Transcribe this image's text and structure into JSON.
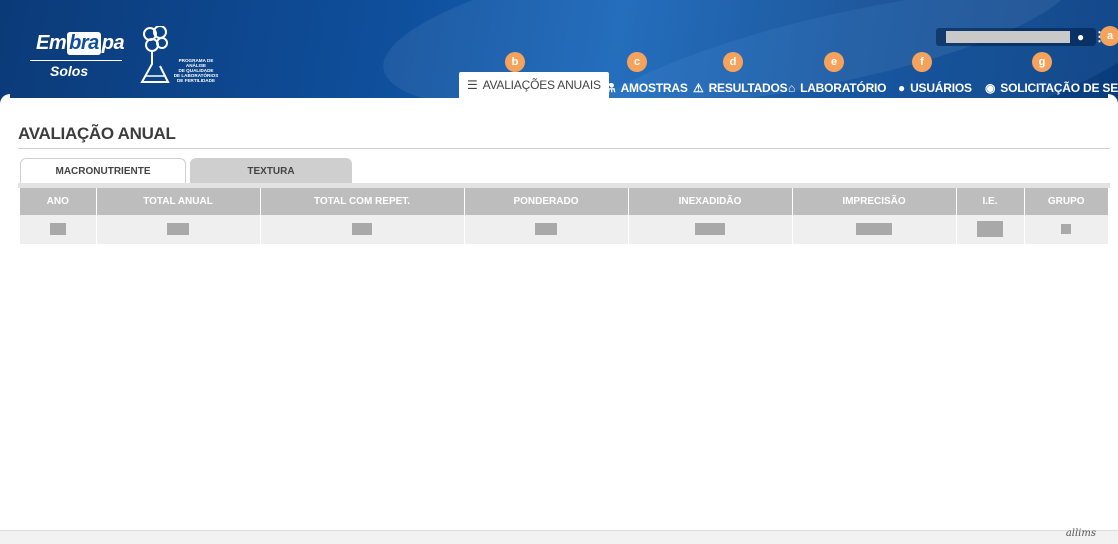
{
  "header": {
    "logo": {
      "brand": "Em",
      "brand_mid": "bra",
      "brand_end": "pa",
      "sub": "Solos"
    },
    "program_text": [
      "PROGRAMA DE ANÁLISE",
      "DE QUALIDADE",
      "DE LABORATÓRIOS",
      "DE FERTILIDADE"
    ],
    "user_badge": "a"
  },
  "nav": [
    {
      "label": "AVALIAÇÕES ANUAIS",
      "icon": "list-icon",
      "glyph": "☰",
      "badge": "b",
      "active": true
    },
    {
      "label": "AMOSTRAS",
      "icon": "samples-icon",
      "glyph": "⚗",
      "badge": "c",
      "active": false
    },
    {
      "label": "RESULTADOS",
      "icon": "flask-icon",
      "glyph": "⚠",
      "badge": "d",
      "active": false
    },
    {
      "label": "LABORATÓRIO",
      "icon": "home-icon",
      "glyph": "⌂",
      "badge": "e",
      "active": false
    },
    {
      "label": "USUÁRIOS",
      "icon": "user-icon",
      "glyph": "●",
      "badge": "f",
      "active": false
    },
    {
      "label": "SOLICITAÇÃO DE SELOS",
      "icon": "seal-icon",
      "glyph": "◉",
      "badge": "g",
      "active": false
    }
  ],
  "page": {
    "title": "AVALIAÇÃO ANUAL"
  },
  "tabs": [
    {
      "label": "MACRONUTRIENTE",
      "active": true
    },
    {
      "label": "TEXTURA",
      "active": false
    }
  ],
  "table": {
    "columns": [
      "ANO",
      "TOTAL ANUAL",
      "TOTAL COM REPET.",
      "PONDERADO",
      "INEXADIDÃO",
      "IMPRECISÃO",
      "I.E.",
      "GRUPO"
    ]
  },
  "footer": {
    "brand": "allims"
  },
  "colors": {
    "header_blue": "#0f4f9c",
    "badge_orange": "#f5a35c",
    "table_header": "#bdbdbd"
  }
}
